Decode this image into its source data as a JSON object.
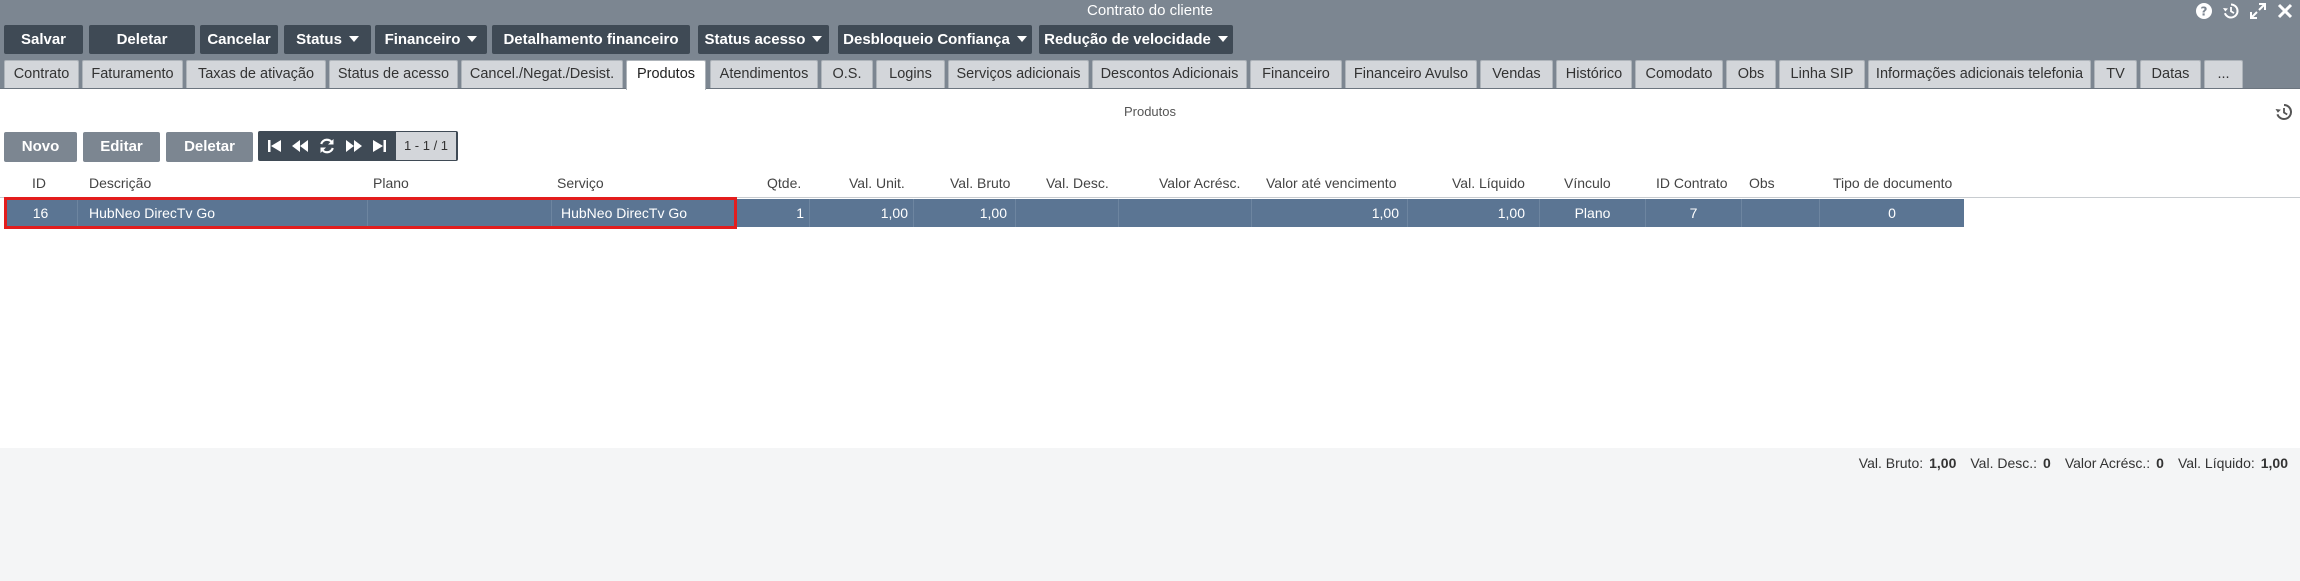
{
  "window": {
    "title": "Contrato do cliente"
  },
  "toolbar": {
    "salvar": "Salvar",
    "deletar": "Deletar",
    "cancelar": "Cancelar",
    "status": "Status",
    "financeiro": "Financeiro",
    "detalhamento": "Detalhamento financeiro",
    "status_acesso": "Status acesso",
    "desbloqueio": "Desbloqueio Confiança",
    "reducao": "Redução de velocidade"
  },
  "tabs": [
    "Contrato",
    "Faturamento",
    "Taxas de ativação",
    "Status de acesso",
    "Cancel./Negat./Desist.",
    "Produtos",
    "Atendimentos",
    "O.S.",
    "Logins",
    "Serviços adicionais",
    "Descontos Adicionais",
    "Financeiro",
    "Financeiro Avulso",
    "Vendas",
    "Histórico",
    "Comodato",
    "Obs",
    "Linha SIP",
    "Informações adicionais telefonia",
    "TV",
    "Datas",
    "..."
  ],
  "section": {
    "title": "Produtos"
  },
  "grid_toolbar": {
    "novo": "Novo",
    "editar": "Editar",
    "deletar": "Deletar",
    "page_count": "1 - 1 / 1"
  },
  "columns": {
    "id": "ID",
    "descricao": "Descrição",
    "plano": "Plano",
    "servico": "Serviço",
    "qtde": "Qtde.",
    "val_unit": "Val. Unit.",
    "val_bruto": "Val. Bruto",
    "val_desc": "Val. Desc.",
    "valor_acresc": "Valor Acrésc.",
    "valor_vencimento": "Valor até vencimento",
    "val_liquido": "Val. Líquido",
    "vinculo": "Vínculo",
    "id_contrato": "ID Contrato",
    "obs": "Obs",
    "tipo_documento": "Tipo de documento"
  },
  "rows": [
    {
      "id": "16",
      "descricao": "HubNeo DirecTv Go",
      "plano": "",
      "servico": "HubNeo DirecTv Go",
      "qtde": "1",
      "val_unit": "1,00",
      "val_bruto": "1,00",
      "val_desc": "",
      "valor_acresc": "",
      "valor_vencimento": "1,00",
      "val_liquido": "1,00",
      "vinculo": "Plano",
      "id_contrato": "7",
      "obs": "",
      "tipo_documento": "0"
    }
  ],
  "totals": {
    "val_bruto_label": "Val. Bruto:",
    "val_bruto": "1,00",
    "val_desc_label": "Val. Desc.:",
    "val_desc": "0",
    "valor_acresc_label": "Valor Acrésc.:",
    "valor_acresc": "0",
    "val_liquido_label": "Val. Líquido:",
    "val_liquido": "1,00"
  }
}
